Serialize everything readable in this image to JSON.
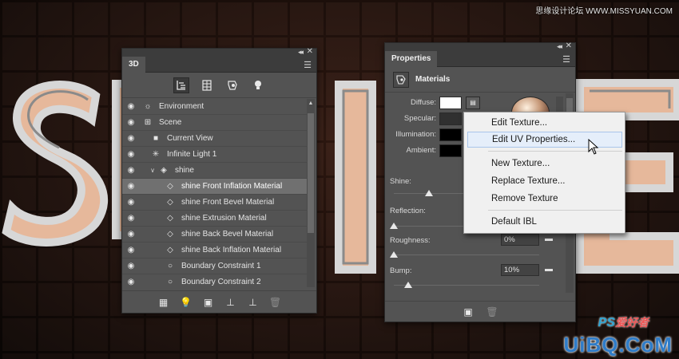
{
  "site_mark": "思缘设计论坛 WWW.MISSYUAN.COM",
  "watermarks": {
    "ps_text": "PS",
    "ps_suffix": "爱好者",
    "uibq": "UiBQ.CoM"
  },
  "panel_3d": {
    "tab": "3D",
    "toolbar_icons": [
      "scene-filter-icon",
      "mesh-filter-icon",
      "material-filter-icon",
      "light-filter-icon"
    ],
    "layers": [
      {
        "label": "Environment",
        "icon": "environment-icon",
        "indent": 0
      },
      {
        "label": "Scene",
        "icon": "scene-icon",
        "indent": 0
      },
      {
        "label": "Current View",
        "icon": "camera-icon",
        "indent": 1
      },
      {
        "label": "Infinite Light 1",
        "icon": "light-icon",
        "indent": 1
      },
      {
        "label": "shine",
        "icon": "mesh-icon",
        "indent": 1,
        "expanded": true
      },
      {
        "label": "shine Front Inflation Material",
        "icon": "material-icon",
        "indent": 2,
        "selected": true
      },
      {
        "label": "shine Front Bevel Material",
        "icon": "material-icon",
        "indent": 2
      },
      {
        "label": "shine Extrusion Material",
        "icon": "material-icon",
        "indent": 2
      },
      {
        "label": "shine Back Bevel Material",
        "icon": "material-icon",
        "indent": 2
      },
      {
        "label": "shine Back Inflation Material",
        "icon": "material-icon",
        "indent": 2
      },
      {
        "label": "Boundary Constraint 1",
        "icon": "constraint-icon",
        "indent": 2
      },
      {
        "label": "Boundary Constraint 2",
        "icon": "constraint-icon",
        "indent": 2
      }
    ],
    "footer_icons": [
      "mesh-add-icon",
      "light-add-icon",
      "render-icon",
      "ground-icon",
      "ground-align-icon",
      "trash-icon"
    ]
  },
  "panel_properties": {
    "tab": "Properties",
    "section_title": "Materials",
    "swatches": [
      {
        "label": "Diffuse:",
        "color": "#ffffff"
      },
      {
        "label": "Specular:",
        "color": "#303030"
      },
      {
        "label": "Illumination:",
        "color": "#000000"
      },
      {
        "label": "Ambient:",
        "color": "#000000"
      }
    ],
    "shine": {
      "label": "Shine:",
      "level": 0.24
    },
    "reflection": {
      "label": "Reflection:",
      "level": 0.0
    },
    "roughness": {
      "label": "Roughness:",
      "value": "0%",
      "level": 0.0
    },
    "bump": {
      "label": "Bump:",
      "value": "10%",
      "level": 0.1
    }
  },
  "context_menu": {
    "items": [
      {
        "label": "Edit Texture...",
        "hover": false
      },
      {
        "label": "Edit UV Properties...",
        "hover": true
      },
      {
        "label": "New Texture...",
        "hover": false
      },
      {
        "label": "Replace Texture...",
        "hover": false
      },
      {
        "label": "Remove Texture",
        "hover": false
      },
      {
        "label": "Default IBL",
        "hover": false
      }
    ]
  },
  "accent_colors": {
    "selection": "#707070",
    "menu_hover": "#e5eefa",
    "menu_hover_border": "#a9c5ea",
    "panel_bg": "#535353"
  }
}
